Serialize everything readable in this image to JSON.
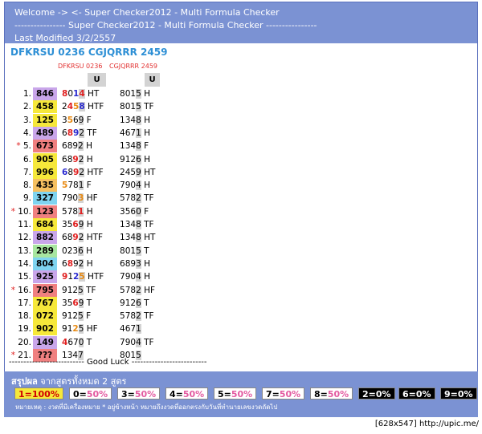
{
  "header": {
    "line1": "Welcome -> <- Super Checker2012 - Multi Formula Checker",
    "line2": "---------------- Super Checker2012 - Multi Formula Checker ----------------",
    "line3": "Last Modified 3/2/2557"
  },
  "title": "DFKRSU 0236 CGJQRRR 2459",
  "columns": {
    "col1": "DFKRSU 0236",
    "col2": "CGJQRRR 2459",
    "u": "U"
  },
  "colors": {
    "header_bg": "#7b92d3",
    "title": "#2d8fd5",
    "hit": "#f6e83a",
    "red": "#e02020",
    "blue": "#2a2ad0",
    "orange": "#e88a12"
  },
  "rows": [
    {
      "label": "1.",
      "star": "",
      "num": "846",
      "bg": "#c9a6ea",
      "c1": [
        [
          "8",
          "red"
        ],
        [
          "0",
          "k"
        ],
        [
          "1",
          "blue"
        ],
        [
          "4",
          "red"
        ]
      ],
      "c1s": "HT",
      "c2": "8015",
      "c2s": "H"
    },
    {
      "label": "2.",
      "star": "",
      "num": "458",
      "bg": "#f6e83a",
      "c1": [
        [
          "2",
          "k"
        ],
        [
          "4",
          "red"
        ],
        [
          "5",
          "orange"
        ],
        [
          "8",
          "blue"
        ]
      ],
      "c1s": "HTF",
      "c2": "8015",
      "c2s": "TF"
    },
    {
      "label": "3.",
      "star": "",
      "num": "125",
      "bg": "#f6e83a",
      "c1": [
        [
          "3",
          "k"
        ],
        [
          "5",
          "orange"
        ],
        [
          "6",
          "k"
        ],
        [
          "9",
          "k"
        ]
      ],
      "c1s": "F",
      "c2": "1348",
      "c2s": "H"
    },
    {
      "label": "4.",
      "star": "",
      "num": "489",
      "bg": "#c9a6ea",
      "c1": [
        [
          "6",
          "k"
        ],
        [
          "8",
          "red"
        ],
        [
          "9",
          "blue"
        ],
        [
          "2",
          "k"
        ]
      ],
      "c1s": "TF",
      "c2": "4671",
      "c2s": "H"
    },
    {
      "label": "5.",
      "star": "*",
      "num": "673",
      "bg": "#f08080",
      "c1": [
        [
          "6",
          "k"
        ],
        [
          "8",
          "k"
        ],
        [
          "9",
          "k"
        ],
        [
          "2",
          "k"
        ]
      ],
      "c1s": "H",
      "c2": "1348",
      "c2s": "F"
    },
    {
      "label": "6.",
      "star": "",
      "num": "905",
      "bg": "#f6e83a",
      "c1": [
        [
          "6",
          "k"
        ],
        [
          "8",
          "k"
        ],
        [
          "9",
          "red"
        ],
        [
          "2",
          "k"
        ]
      ],
      "c1s": "H",
      "c2": "9126",
      "c2s": "H"
    },
    {
      "label": "7.",
      "star": "",
      "num": "996",
      "bg": "#f6e83a",
      "c1": [
        [
          "6",
          "blue"
        ],
        [
          "8",
          "k"
        ],
        [
          "9",
          "red"
        ],
        [
          "2",
          "k"
        ]
      ],
      "c1s": "HTF",
      "c2": "2459",
      "c2s": "HT"
    },
    {
      "label": "8.",
      "star": "",
      "num": "435",
      "bg": "#f6c060",
      "c1": [
        [
          "5",
          "orange"
        ],
        [
          "7",
          "k"
        ],
        [
          "8",
          "k"
        ],
        [
          "1",
          "k"
        ]
      ],
      "c1s": "F",
      "c2": "7904",
      "c2s": "H"
    },
    {
      "label": "9.",
      "star": "",
      "num": "327",
      "bg": "#7fd4f0",
      "c1": [
        [
          "7",
          "k"
        ],
        [
          "9",
          "k"
        ],
        [
          "0",
          "k"
        ],
        [
          "3",
          "orange"
        ]
      ],
      "c1s": "HF",
      "c2": "5782",
      "c2s": "TF"
    },
    {
      "label": "10.",
      "star": "*",
      "num": "123",
      "bg": "#f08080",
      "c1": [
        [
          "5",
          "k"
        ],
        [
          "7",
          "k"
        ],
        [
          "8",
          "k"
        ],
        [
          "1",
          "red"
        ]
      ],
      "c1s": "H",
      "c2": "3560",
      "c2s": "F"
    },
    {
      "label": "11.",
      "star": "",
      "num": "684",
      "bg": "#f6e83a",
      "c1": [
        [
          "3",
          "k"
        ],
        [
          "5",
          "k"
        ],
        [
          "6",
          "red"
        ],
        [
          "9",
          "k"
        ]
      ],
      "c1s": "H",
      "c2": "1348",
      "c2s": "TF"
    },
    {
      "label": "12.",
      "star": "",
      "num": "882",
      "bg": "#c9a6ea",
      "c1": [
        [
          "6",
          "k"
        ],
        [
          "8",
          "k"
        ],
        [
          "9",
          "red"
        ],
        [
          "2",
          "k"
        ]
      ],
      "c1s": "HTF",
      "c2": "1348",
      "c2s": "HT"
    },
    {
      "label": "13.",
      "star": "",
      "num": "289",
      "bg": "#a8e6a0",
      "c1": [
        [
          "0",
          "k"
        ],
        [
          "2",
          "k"
        ],
        [
          "3",
          "k"
        ],
        [
          "6",
          "k"
        ]
      ],
      "c1s": "H",
      "c2": "8015",
      "c2s": "T"
    },
    {
      "label": "14.",
      "star": "",
      "num": "804",
      "bg": "#7fd4f0",
      "c1": [
        [
          "6",
          "k"
        ],
        [
          "8",
          "red"
        ],
        [
          "9",
          "k"
        ],
        [
          "2",
          "k"
        ]
      ],
      "c1s": "H",
      "c2": "6893",
      "c2s": "H"
    },
    {
      "label": "15.",
      "star": "",
      "num": "925",
      "bg": "#c9a6ea",
      "c1": [
        [
          "9",
          "red"
        ],
        [
          "1",
          "k"
        ],
        [
          "2",
          "blue"
        ],
        [
          "5",
          "orange"
        ]
      ],
      "c1s": "HTF",
      "c2": "7904",
      "c2s": "H"
    },
    {
      "label": "16.",
      "star": "*",
      "num": "795",
      "bg": "#f08080",
      "c1": [
        [
          "9",
          "k"
        ],
        [
          "1",
          "k"
        ],
        [
          "2",
          "k"
        ],
        [
          "5",
          "k"
        ]
      ],
      "c1s": "TF",
      "c2": "5782",
      "c2s": "HF"
    },
    {
      "label": "17.",
      "star": "",
      "num": "767",
      "bg": "#f6e83a",
      "c1": [
        [
          "3",
          "k"
        ],
        [
          "5",
          "k"
        ],
        [
          "6",
          "red"
        ],
        [
          "9",
          "k"
        ]
      ],
      "c1s": "T",
      "c2": "9126",
      "c2s": "T"
    },
    {
      "label": "18.",
      "star": "",
      "num": "072",
      "bg": "#f6e83a",
      "c1": [
        [
          "9",
          "k"
        ],
        [
          "1",
          "k"
        ],
        [
          "2",
          "k"
        ],
        [
          "5",
          "k"
        ]
      ],
      "c1s": "F",
      "c2": "5782",
      "c2s": "TF"
    },
    {
      "label": "19.",
      "star": "",
      "num": "902",
      "bg": "#f6e83a",
      "c1": [
        [
          "9",
          "k"
        ],
        [
          "1",
          "k"
        ],
        [
          "2",
          "orange"
        ],
        [
          "5",
          "k"
        ]
      ],
      "c1s": "HF",
      "c2": "4671",
      "c2s": ""
    },
    {
      "label": "20.",
      "star": "",
      "num": "149",
      "bg": "#c9a6ea",
      "c1": [
        [
          "4",
          "red"
        ],
        [
          "6",
          "k"
        ],
        [
          "7",
          "k"
        ],
        [
          "0",
          "k"
        ]
      ],
      "c1s": "T",
      "c2": "7904",
      "c2s": "TF"
    },
    {
      "label": "21.",
      "star": "*",
      "num": "???",
      "bg": "#f08080",
      "c1": [
        [
          "1",
          "k"
        ],
        [
          "3",
          "k"
        ],
        [
          "4",
          "k"
        ],
        [
          "7",
          "k"
        ]
      ],
      "c1s": "",
      "c2": "8015",
      "c2s": ""
    }
  ],
  "separator": "-------------------------- Good Luck --------------------------",
  "summary": {
    "label": "สรุปผล",
    "text": "จากสูตรทั้งหมด 2 สูตร"
  },
  "badges": [
    {
      "text": "1=100%",
      "type": "hit"
    },
    {
      "text": "0=",
      "pct": "50%",
      "type": "light"
    },
    {
      "text": "3=",
      "pct": "50%",
      "type": "light"
    },
    {
      "text": "4=",
      "pct": "50%",
      "type": "light"
    },
    {
      "text": "5=",
      "pct": "50%",
      "type": "light"
    },
    {
      "text": "7=",
      "pct": "50%",
      "type": "light"
    },
    {
      "text": "8=",
      "pct": "50%",
      "type": "light"
    },
    {
      "text": "2=0%",
      "type": "dark"
    },
    {
      "text": "6=0%",
      "type": "dark"
    },
    {
      "text": "9=0%",
      "type": "dark"
    }
  ],
  "note": "หมายเหตุ : งวดที่มีเครื่องหมาย * อยู่ข้างหน้า หมายถึงงวดที่ออกตรงกับวันที่ทำนายเลขงวดถัดไป",
  "footer": "[628x547] http://upic.me/"
}
